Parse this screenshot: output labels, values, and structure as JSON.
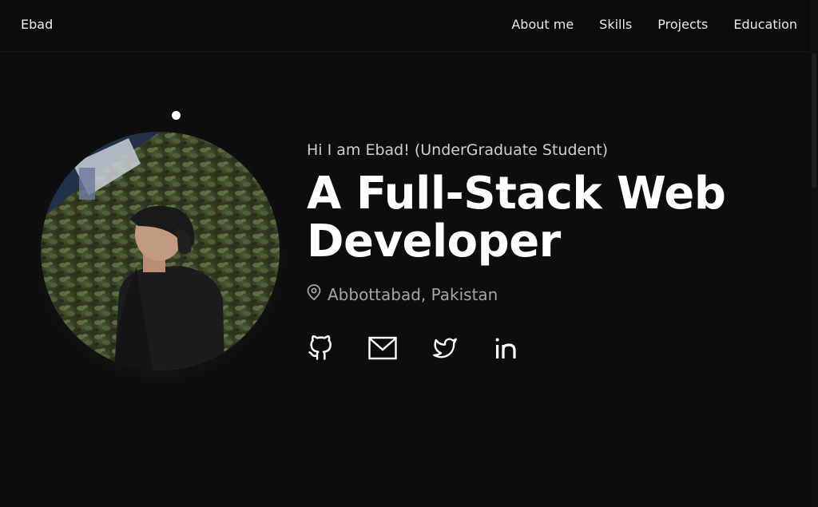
{
  "navbar": {
    "brand": "Ebad",
    "links": [
      {
        "label": "About me"
      },
      {
        "label": "Skills"
      },
      {
        "label": "Projects"
      },
      {
        "label": "Education"
      }
    ]
  },
  "hero": {
    "greeting": "Hi I am Ebad! (UnderGraduate Student)",
    "headline_line1": "A Full-Stack Web",
    "headline_line2": "Developer",
    "location": "Abbottabad, Pakistan",
    "socials": [
      {
        "name": "github",
        "icon": "github-icon"
      },
      {
        "name": "email",
        "icon": "mail-icon"
      },
      {
        "name": "twitter",
        "icon": "twitter-icon"
      },
      {
        "name": "linkedin",
        "icon": "linkedin-icon"
      }
    ]
  },
  "colors": {
    "background": "#0d0d0d",
    "navbar": "#0b0b0b",
    "text": "#ffffff",
    "muted": "#a5a5a5"
  }
}
